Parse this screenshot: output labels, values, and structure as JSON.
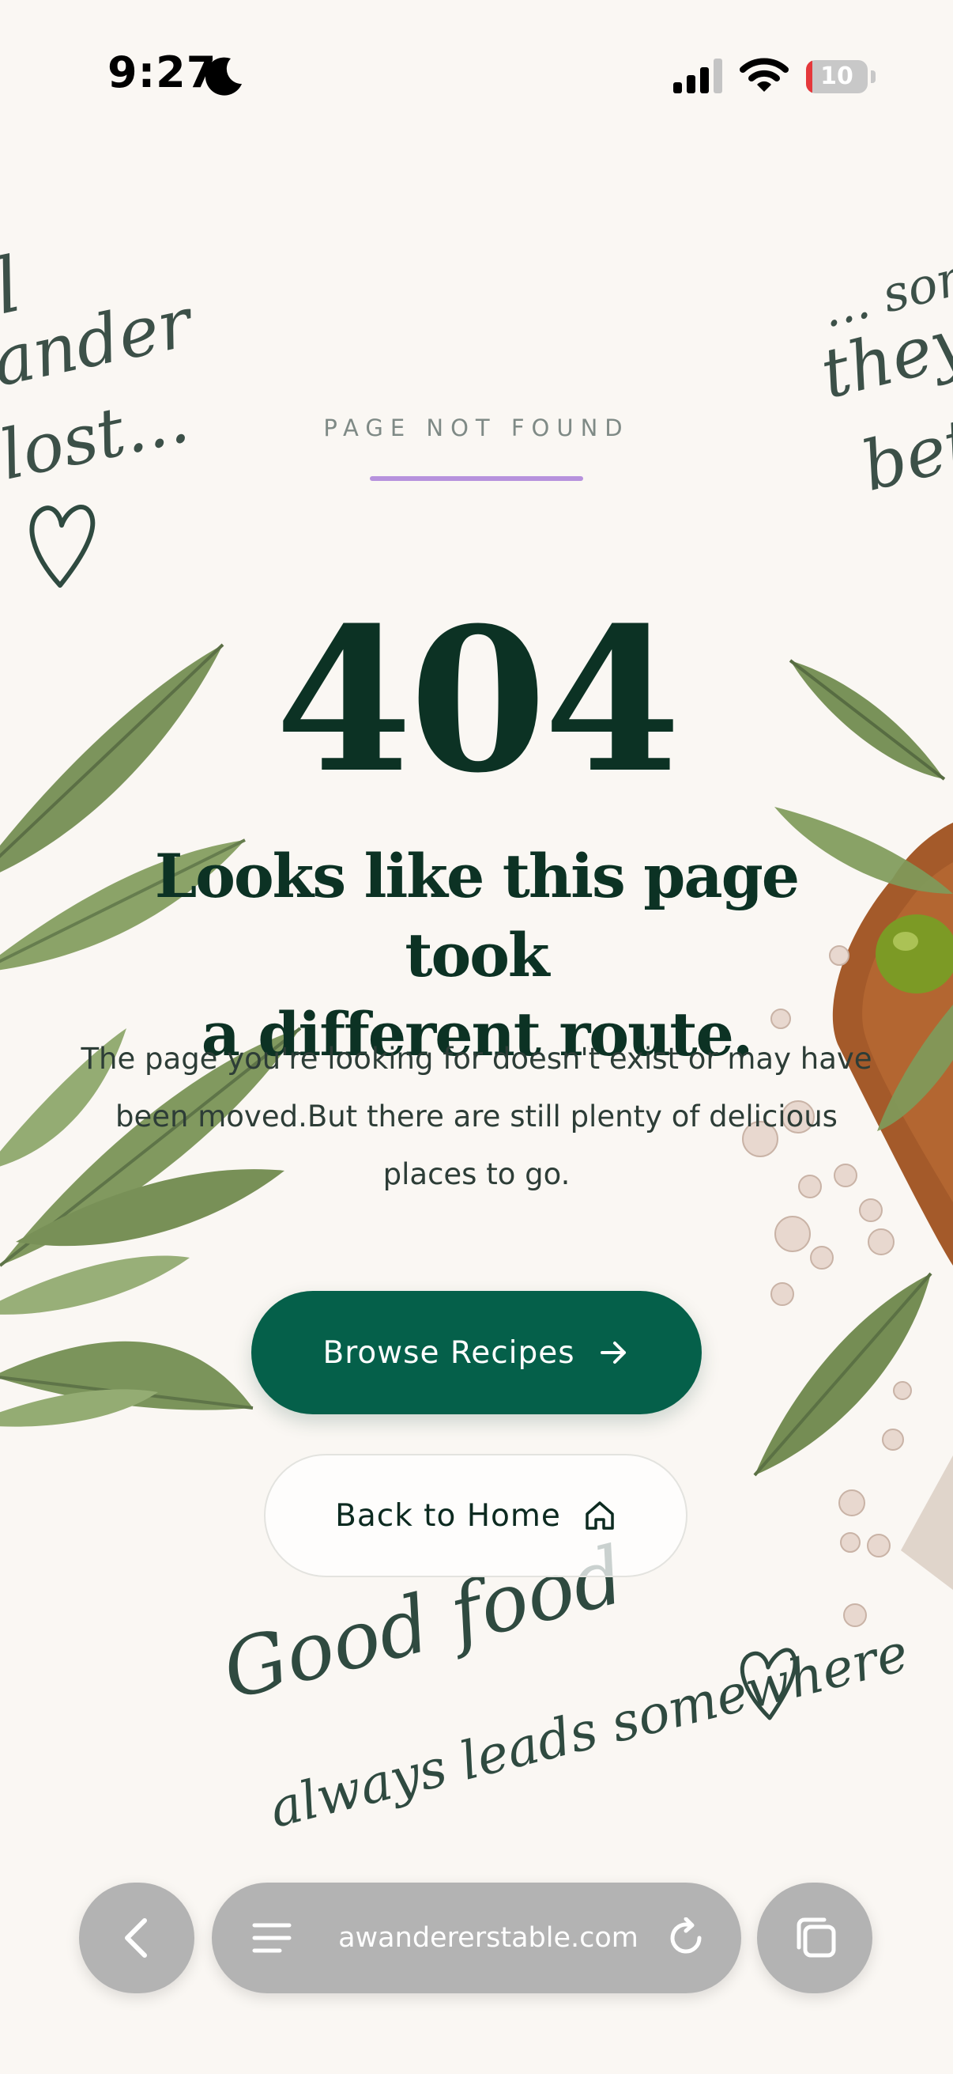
{
  "status_bar": {
    "time": "9:27",
    "battery": "10",
    "battery_level": 0.1,
    "icons": [
      "moon-icon",
      "signal-icon",
      "wifi-icon",
      "battery-icon"
    ]
  },
  "page": {
    "eyebrow": "PAGE NOT FOUND",
    "code": "404",
    "headline_line1": "Looks like this page took",
    "headline_line2": "a different route.",
    "body_line1": "The page you're looking for doesn't exist or may have",
    "body_line2": "been moved.But there are still plenty of delicious",
    "body_line3": "places to go.",
    "primary_button": "Browse Recipes",
    "secondary_button": "Back to Home",
    "script_left_a": "l",
    "script_left_b": "ander",
    "script_left_c": "lost...",
    "script_right_a": "... som",
    "script_right_b": "they",
    "script_right_c": "bett",
    "script_bottom_line1": "Good food",
    "script_bottom_line2": "always leads somewhere"
  },
  "browser": {
    "url": "awandererstable.com"
  },
  "colors": {
    "background": "#faf7f3",
    "ink": "#0c3224",
    "primary": "#05604a",
    "accent_rule": "#b792dd",
    "toolbar": "#b3b3b3"
  }
}
